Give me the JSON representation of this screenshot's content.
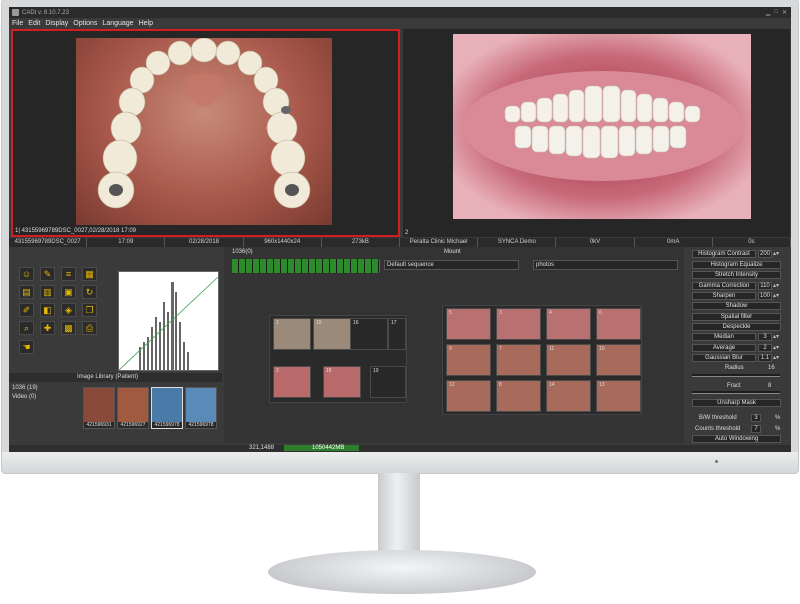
{
  "app": {
    "title": "CADI v. 8.10.7.23"
  },
  "menu": [
    "File",
    "Edit",
    "Display",
    "Options",
    "Language",
    "Help"
  ],
  "viewers": {
    "left_label": "1| 43155969789DSC_0027,02/28/2018 17:09",
    "right_label": "2"
  },
  "infobar": [
    "43155969789DSC_0027",
    "17:09",
    "02/28/2018",
    "960x1440x24",
    "273kB",
    "Peralta Clinic Michael",
    "SYNCA Demo",
    "0kV",
    "0mA",
    "0s"
  ],
  "library": {
    "title": "Image Library (Patient)",
    "count": "1036 (19)",
    "video": "Video (0)",
    "thumbs": [
      "421596931",
      "421596927",
      "421596978",
      "421596978"
    ]
  },
  "center": {
    "top_value": "1036(0)",
    "mount_label": "Mount",
    "sequence": "Default sequence",
    "photos": "photos",
    "grid_nums": [
      "1",
      "15",
      "16",
      "17",
      "2",
      "18",
      "19"
    ],
    "mount_nums": [
      "5",
      "3",
      "4",
      "6",
      "9",
      "7",
      "11",
      "10",
      "12",
      "8",
      "14",
      "13"
    ]
  },
  "right": {
    "histogram_contrast": "Histogram Contrast",
    "histogram_contrast_val": "200",
    "histogram_equalize": "Histogram Equalize",
    "stretch_intensity": "Stretch Intensity",
    "gamma_correction": "Gamma Correction",
    "gamma_val": "110",
    "sharpen": "Sharpen",
    "sharpen_val": "100",
    "shadow": "Shadow",
    "spatial_filter": "Spatial filter",
    "despeckle": "Despeckle",
    "median": "Median",
    "median_val": "3",
    "average": "Average",
    "average_val": "2",
    "gaussian_blur": "Gaussian Blur",
    "gaussian_val": "1.1",
    "radius": "Radius",
    "radius_val": "16",
    "fract": "Fract",
    "fract_val": "8",
    "unsharp_mask": "Unsharp Mask",
    "bw_threshold": "B/W threshold",
    "bw_val": "3",
    "percent": "%",
    "counts_threshold": "Counts threshold",
    "counts_val": "7",
    "auto_windowing": "Auto Windowing"
  },
  "status": {
    "coords": "321,1488",
    "memory": "1050442MB"
  }
}
